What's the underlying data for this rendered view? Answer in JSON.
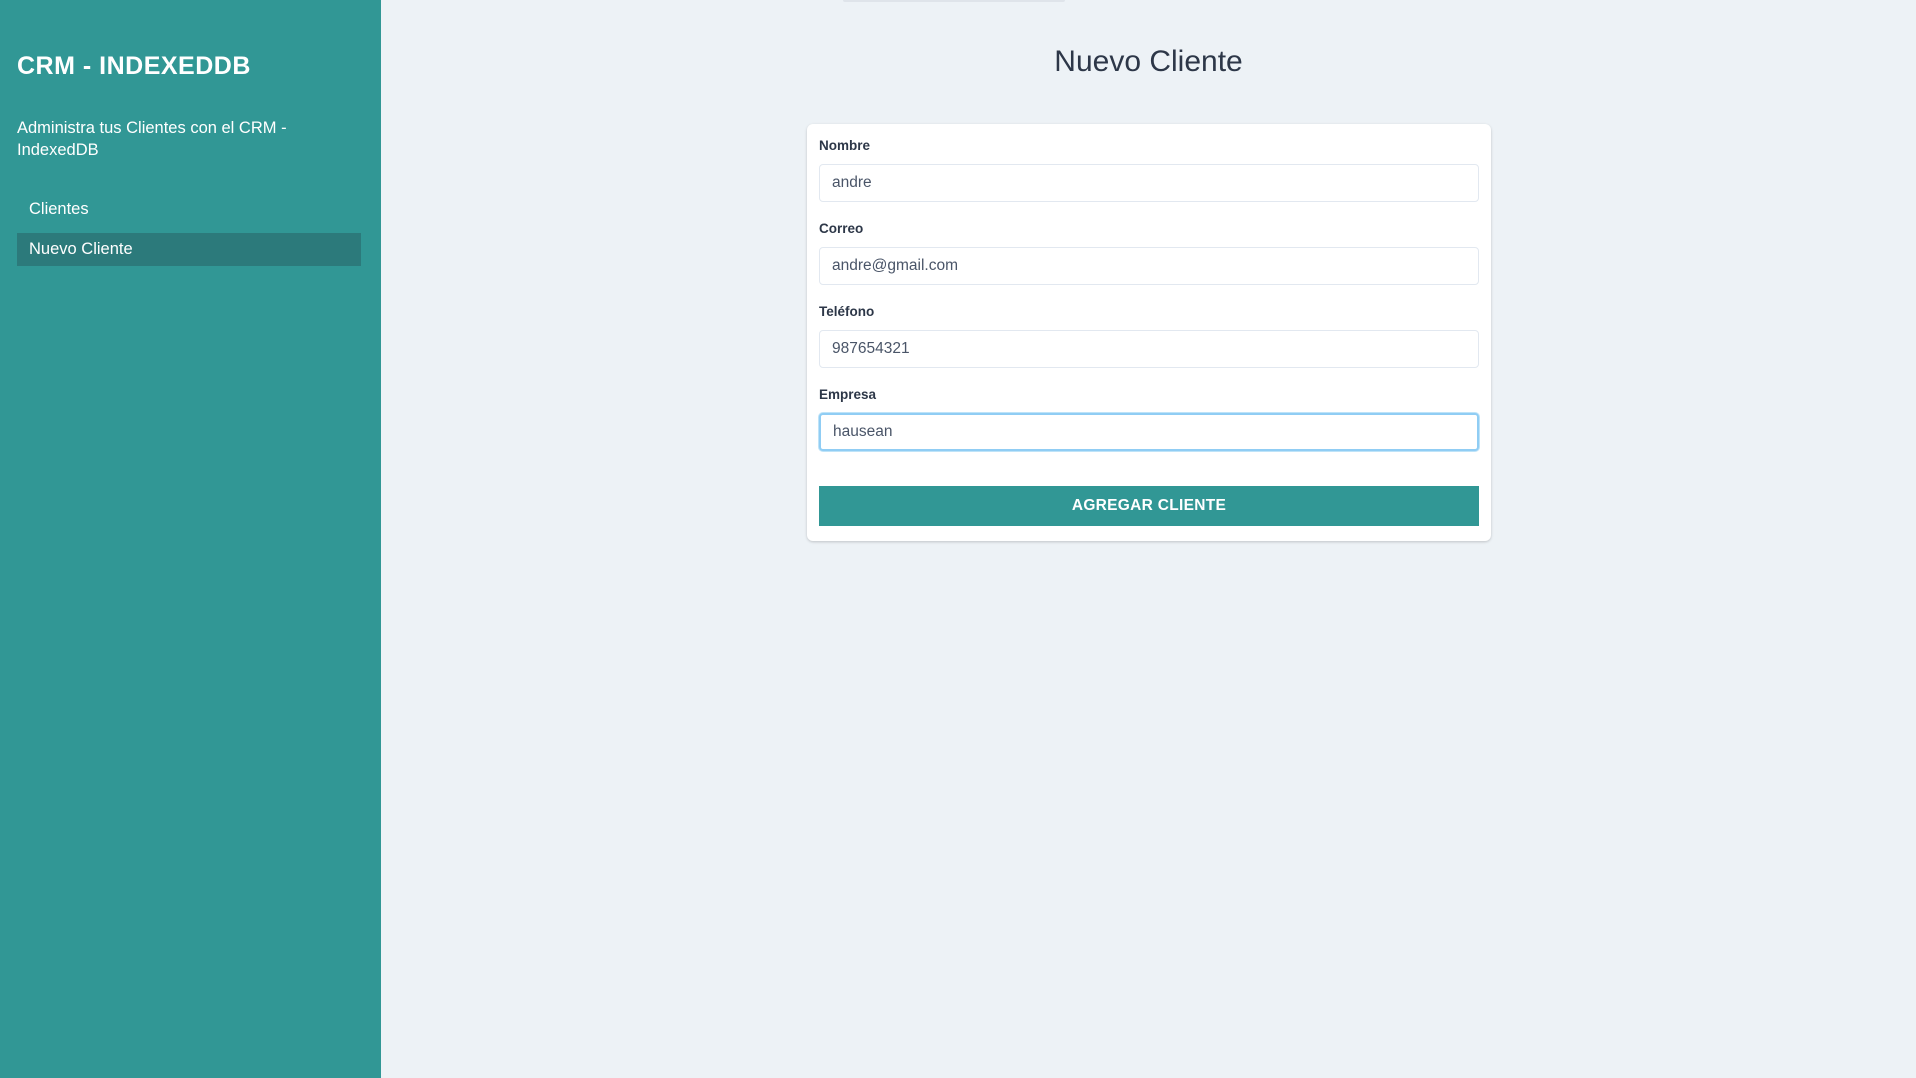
{
  "sidebar": {
    "brand": "CRM - INDEXEDDB",
    "tagline": "Administra tus Clientes con el CRM - IndexedDB",
    "nav": [
      {
        "label": "Clientes",
        "active": false
      },
      {
        "label": "Nuevo Cliente",
        "active": true
      }
    ]
  },
  "main": {
    "title": "Nuevo Cliente",
    "form": {
      "fields": [
        {
          "label": "Nombre",
          "value": "andre"
        },
        {
          "label": "Correo",
          "value": "andre@gmail.com"
        },
        {
          "label": "Teléfono",
          "value": "987654321"
        },
        {
          "label": "Empresa",
          "value": "hausean",
          "focused": true
        }
      ],
      "submit_label": "AGREGAR CLIENTE"
    }
  },
  "colors": {
    "sidebar_bg": "#319795",
    "nav_active_bg": "#2c7a7b",
    "page_bg": "#edf2f6",
    "button_bg": "#319795",
    "focus_ring": "#90cdf4"
  }
}
